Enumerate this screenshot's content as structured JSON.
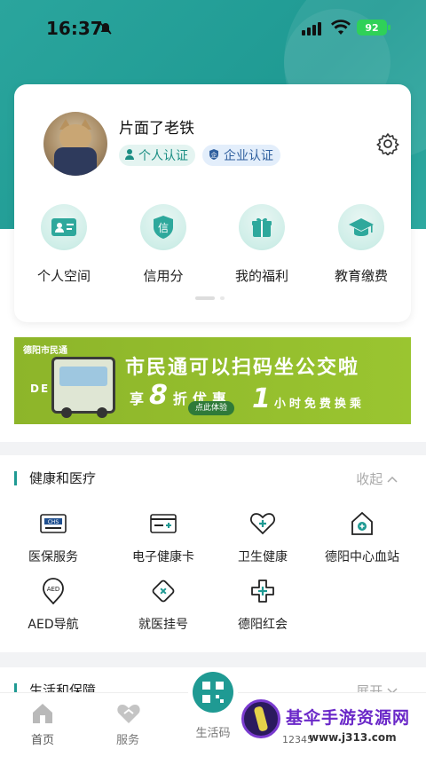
{
  "status_bar": {
    "time": "16:37",
    "battery": "92"
  },
  "profile": {
    "username": "片面了老铁",
    "badge_personal": "个人认证",
    "badge_enterprise": "企业认证"
  },
  "quick_links": [
    {
      "label": "个人空间",
      "icon": "id-card-icon"
    },
    {
      "label": "信用分",
      "icon": "credit-shield-icon"
    },
    {
      "label": "我的福利",
      "icon": "gift-icon"
    },
    {
      "label": "教育缴费",
      "icon": "graduation-cap-icon"
    }
  ],
  "banner": {
    "logo": "德阳市民通",
    "city": "DE YANG",
    "title": "市民通可以扫码坐公交啦",
    "sub_prefix": "享",
    "sub_number": "8",
    "sub_suffix": "折优惠",
    "button": "点此体验",
    "hour_number": "1",
    "hour_text": "小时免费换乘"
  },
  "health_section": {
    "title": "健康和医疗",
    "toggle": "收起",
    "items": [
      {
        "label": "医保服务",
        "icon": "medical-insurance-icon"
      },
      {
        "label": "电子健康卡",
        "icon": "health-card-icon"
      },
      {
        "label": "卫生健康",
        "icon": "heart-plus-icon"
      },
      {
        "label": "德阳中心血站",
        "icon": "blood-station-icon"
      },
      {
        "label": "AED导航",
        "icon": "aed-location-icon"
      },
      {
        "label": "就医挂号",
        "icon": "registration-ticket-icon"
      },
      {
        "label": "德阳红会",
        "icon": "red-cross-icon"
      }
    ]
  },
  "life_section": {
    "title": "生活和保障",
    "toggle": "展开"
  },
  "tabbar": {
    "items": [
      {
        "label": "首页",
        "icon": "home-icon"
      },
      {
        "label": "服务",
        "icon": "services-icon"
      },
      {
        "label": "生活码",
        "icon": "qr-code-icon"
      }
    ],
    "partial_number": "12345"
  },
  "watermark": {
    "title": "基伞手游资源网",
    "url": "www.j313.com"
  },
  "colors": {
    "accent": "#1f9a93",
    "banner_green": "#9ac530"
  }
}
